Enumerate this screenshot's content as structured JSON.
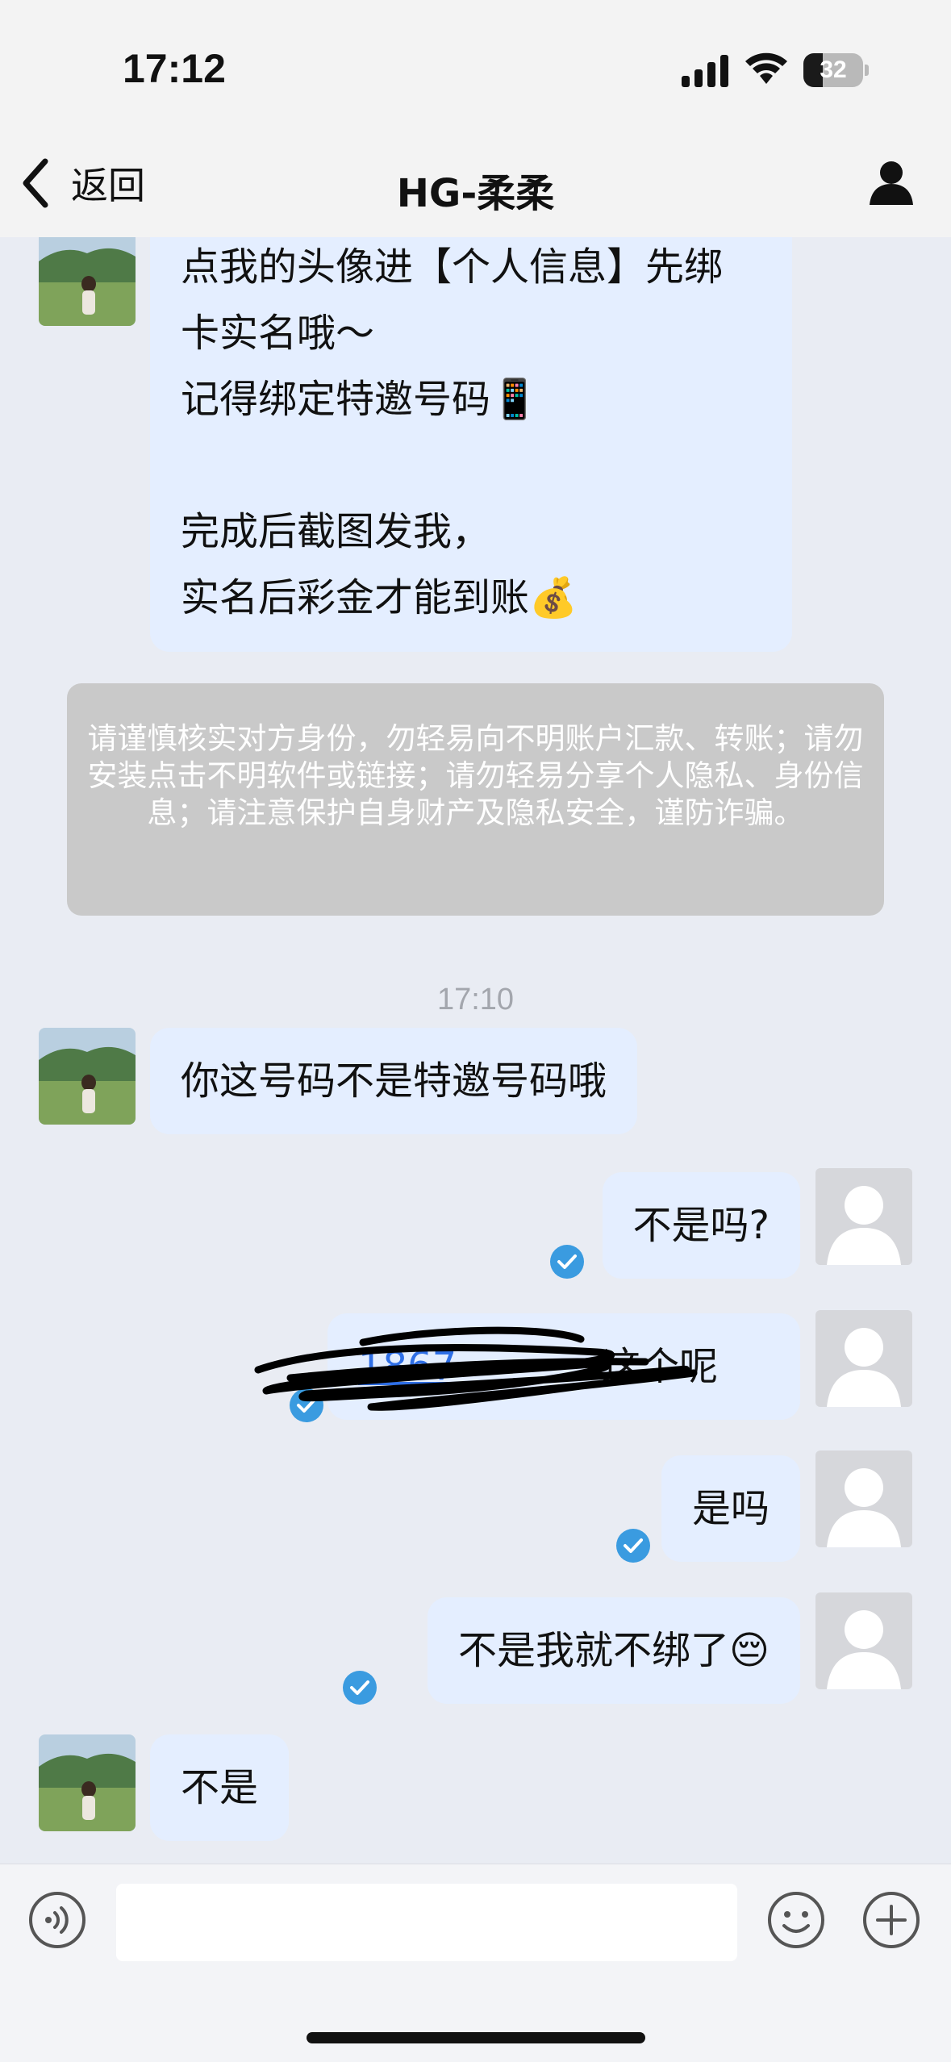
{
  "status_bar": {
    "time": "17:12",
    "battery_level": "32",
    "battery_fraction": 0.32,
    "icons": [
      "cellular-signal-icon",
      "wifi-icon",
      "battery-icon"
    ]
  },
  "nav": {
    "back_label": "返回",
    "title": "HG-柔柔",
    "icons": [
      "chevron-left-icon",
      "person-icon"
    ]
  },
  "messages": {
    "incoming_top_text": "点我的头像进【个人信息】先绑\n卡实名哦～\n记得绑定特邀号码📱\n\n完成后截图发我，\n实名后彩金才能到账💰",
    "warning_text": "请谨慎核实对方身份，勿轻易向不明账户汇款、转账；请勿安装点击不明软件或链接；请勿轻易分享个人隐私、身份信息；请注意保护自身财产及隐私安全，谨防诈骗。",
    "timestamp": "17:10",
    "incoming_1": "你这号码不是特邀号码哦",
    "outgoing_1": "不是吗?",
    "outgoing_2_link": "1867",
    "outgoing_2_suffix": "这个呢",
    "outgoing_3": "是吗",
    "outgoing_4": "不是我就不绑了😔",
    "incoming_2": "不是"
  },
  "input_bar": {
    "placeholder": "",
    "icons": [
      "voice-icon",
      "emoji-icon",
      "plus-icon"
    ]
  },
  "colors": {
    "background": "#e9ecf3",
    "bubble": "#e4eeff",
    "check": "#3a9be0",
    "warning_bg": "#c9c9c9",
    "link": "#2f6fe6"
  }
}
